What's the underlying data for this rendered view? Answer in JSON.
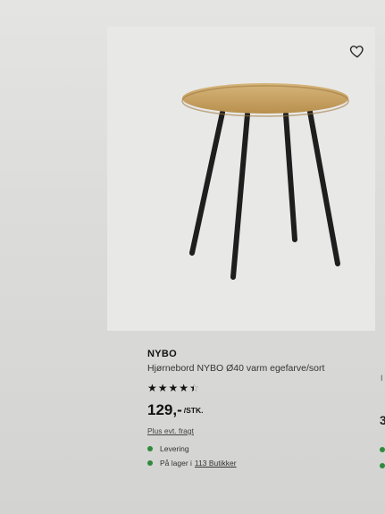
{
  "product": {
    "brand": "NYBO",
    "description": "Hjørnebord NYBO Ø40 varm egefarve/sort",
    "rating": 4.5,
    "price": "129,-",
    "unit": "/STK.",
    "shipping": "Plus evt. fragt",
    "delivery": "Levering",
    "stock_prefix": "På lager i",
    "stock_link": "113 Butikker"
  },
  "neighbor": {
    "fragment_1": "I",
    "price_fragment": "3"
  },
  "colors": {
    "status_green": "#2f8a3d",
    "tabletop": "#c9a56a",
    "legs": "#1e1e1e"
  },
  "icons": {
    "wishlist": "heart-icon",
    "rating": "star-icon"
  }
}
